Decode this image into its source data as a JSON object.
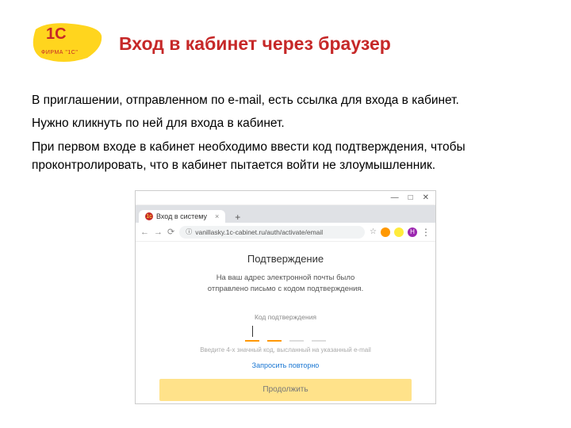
{
  "logo": {
    "main": "1C",
    "sub": "ФИРМА \"1С\""
  },
  "title": "Вход в кабинет через браузер",
  "paragraphs": [
    "В приглашении, отправленном по e-mail, есть ссылка для входа в кабинет.",
    "Нужно кликнуть по ней для входа в кабинет.",
    "При первом входе в кабинет необходимо ввести код подтверждения, чтобы проконтролировать, что в кабинет пытается войти не злоумышленник."
  ],
  "browser": {
    "window": {
      "min": "—",
      "max": "□",
      "close": "✕"
    },
    "tab": {
      "title": "Вход в систему",
      "plus": "+"
    },
    "nav": {
      "back": "←",
      "fwd": "→",
      "reload": "⟳"
    },
    "url": "vanillasky.1c-cabinet.ru/auth/activate/email",
    "avatar": "Н",
    "menu_dots": "⋮"
  },
  "page": {
    "heading": "Подтверждение",
    "desc1": "На ваш адрес электронной почты было",
    "desc2": "отправлено письмо с кодом подтверждения.",
    "field_label": "Код подтверждения",
    "hint": "Введите 4-х значный код, высланный на указанный e-mail",
    "resend": "Запросить повторно",
    "continue": "Продолжить"
  }
}
